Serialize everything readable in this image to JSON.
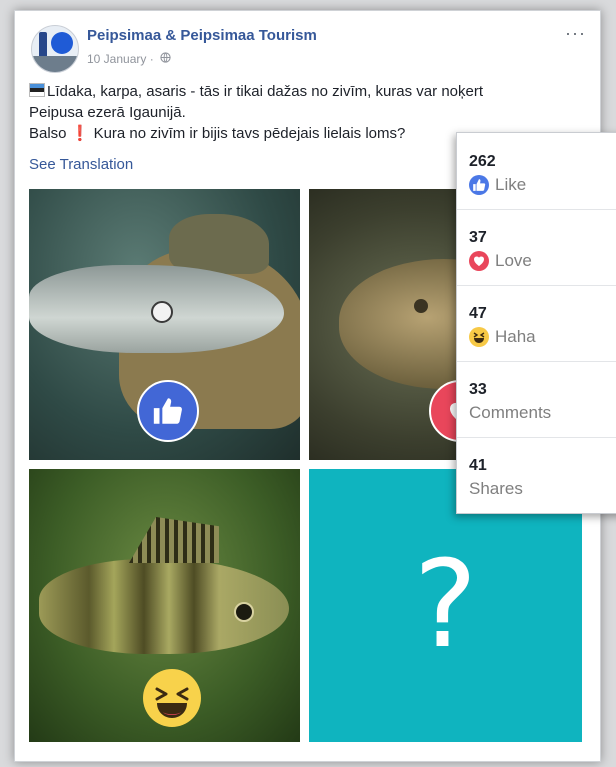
{
  "post": {
    "page_name": "Peipsimaa & Peipsimaa Tourism",
    "date": "10 January",
    "separator": "·",
    "more": "···",
    "text_line1": "Līdaka, karpa, asaris - tās ir tikai dažas no zivīm, kuras var noķert",
    "text_line2": "Peipusa ezerā Igaunijā.",
    "text_line3_a": "Balso",
    "text_line3_b": "Kura no zivīm ir bijis tavs pēdejais lielais loms?",
    "exclaim": "❗",
    "see_translation": "See Translation",
    "question_mark": "?"
  },
  "stats": {
    "like_count": "262",
    "like_label": "Like",
    "love_count": "37",
    "love_label": "Love",
    "haha_count": "47",
    "haha_label": "Haha",
    "comments_count": "33",
    "comments_label": "Comments",
    "shares_count": "41",
    "shares_label": "Shares"
  },
  "colors": {
    "link": "#365899",
    "like": "#4267d6",
    "love": "#e9465b",
    "haha": "#f8d24b",
    "tile_bg": "#0fb4bf"
  }
}
